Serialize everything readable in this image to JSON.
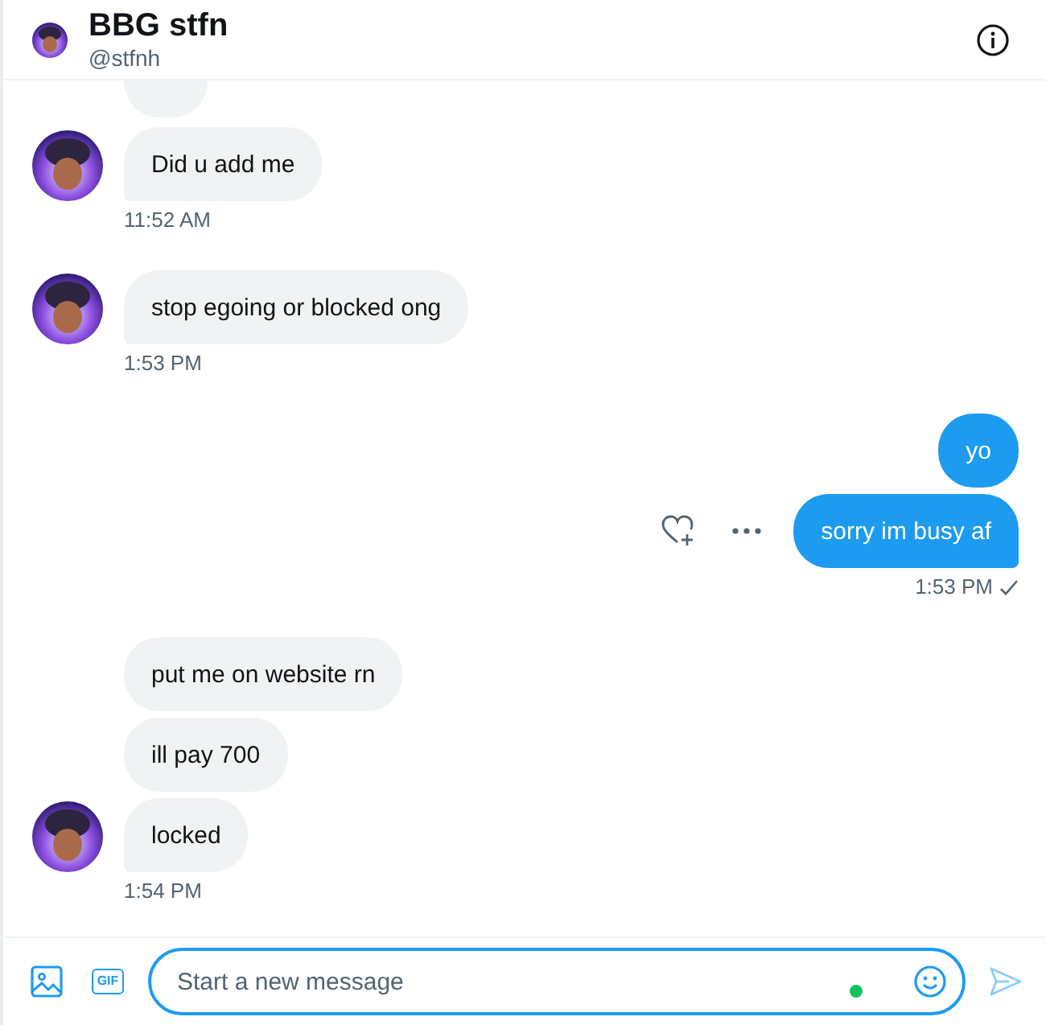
{
  "header": {
    "name": "BBG stfn",
    "handle": "@stfnh"
  },
  "groups": [
    {
      "kind": "them",
      "messages": [
        {
          "text": "Did u add me",
          "actions_visible": false
        }
      ],
      "time": "11:52 AM",
      "read": false
    },
    {
      "kind": "them",
      "messages": [
        {
          "text": "stop egoing or blocked ong",
          "actions_visible": false
        }
      ],
      "time": "1:53 PM",
      "read": false
    },
    {
      "kind": "me",
      "messages": [
        {
          "text": "yo",
          "actions_visible": false
        },
        {
          "text": "sorry im busy af",
          "actions_visible": true
        }
      ],
      "time": "1:53 PM",
      "read": true
    },
    {
      "kind": "them",
      "messages": [
        {
          "text": "put me on website rn",
          "actions_visible": false
        },
        {
          "text": "ill pay 700",
          "actions_visible": false
        },
        {
          "text": "locked",
          "actions_visible": false
        }
      ],
      "time": "1:54 PM",
      "read": false
    }
  ],
  "composer": {
    "gif_label": "GIF",
    "placeholder": "Start a new message"
  }
}
